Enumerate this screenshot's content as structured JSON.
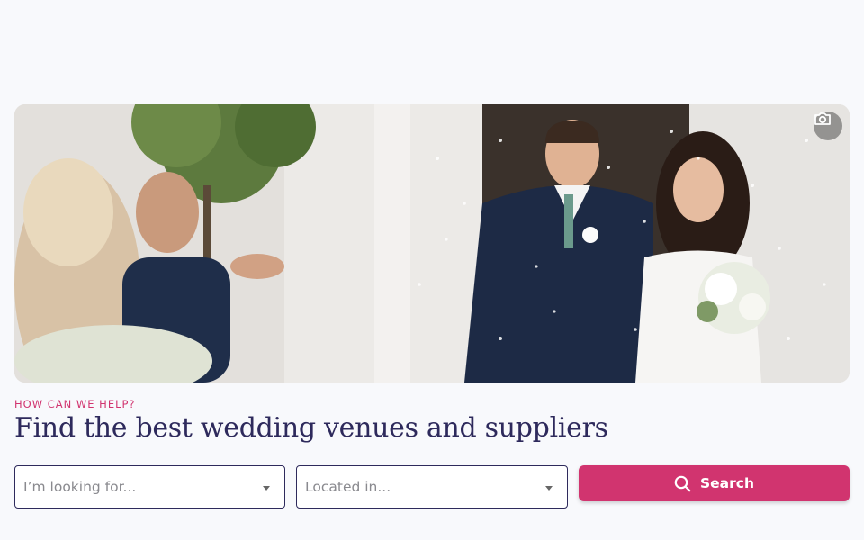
{
  "hero": {
    "image_icon": "camera-icon"
  },
  "search_section": {
    "eyebrow": "HOW CAN WE HELP?",
    "headline": "Find the best wedding venues and suppliers",
    "looking_for": {
      "placeholder": "I’m looking for..."
    },
    "located_in": {
      "placeholder": "Located in..."
    },
    "search_button": {
      "label": "Search",
      "icon": "search-icon"
    }
  },
  "colors": {
    "accent": "#d1346f",
    "heading": "#2e2a5c",
    "background": "#f8f9fc"
  }
}
